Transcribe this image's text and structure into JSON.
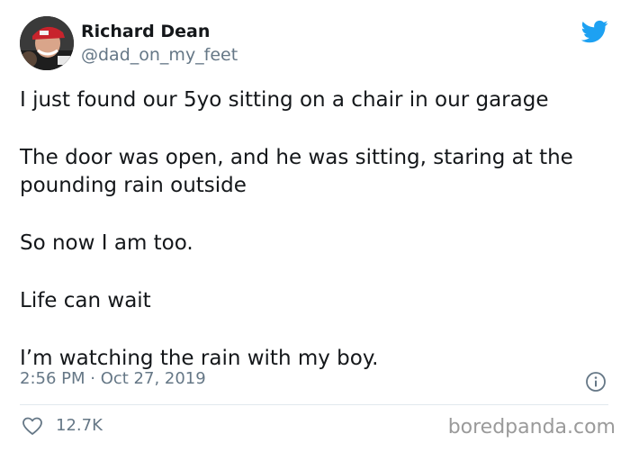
{
  "author": {
    "display_name": "Richard Dean",
    "handle": "@dad_on_my_feet"
  },
  "tweet": {
    "paragraphs": [
      "I just found our 5yo sitting on a chair in our garage",
      "The door was open, and he was sitting, staring at the pounding rain outside",
      "So now I am too.",
      "Life can wait",
      "I’m watching the rain with my boy."
    ],
    "timestamp": "2:56 PM · Oct 27, 2019",
    "likes": "12.7K"
  },
  "icons": {
    "brand": "twitter-bird-icon",
    "info": "info-icon",
    "like": "heart-icon"
  },
  "colors": {
    "twitter_blue": "#1da1f2",
    "secondary_text": "#657786",
    "primary_text": "#14171a",
    "watermark": "#9a9a9a"
  },
  "watermark": "boredpanda.com"
}
